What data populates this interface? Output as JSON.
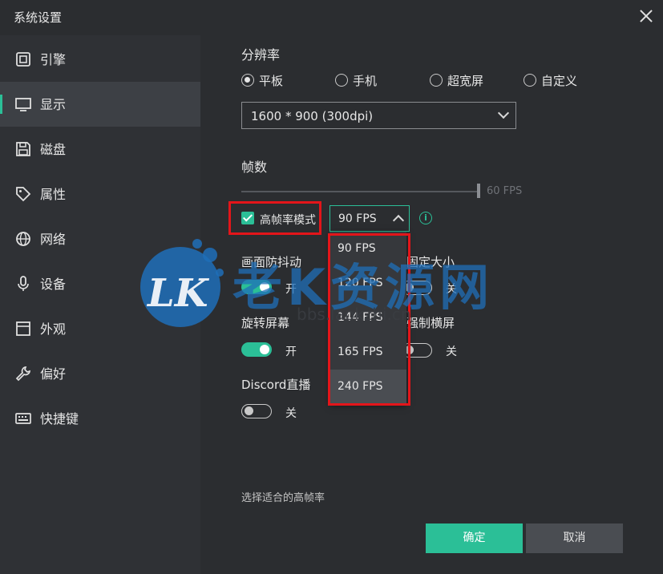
{
  "window": {
    "title": "系统设置"
  },
  "sidebar": {
    "items": [
      {
        "label": "引擎",
        "icon": "chip-icon"
      },
      {
        "label": "显示",
        "icon": "monitor-icon",
        "active": true
      },
      {
        "label": "磁盘",
        "icon": "save-disk-icon"
      },
      {
        "label": "属性",
        "icon": "tag-icon"
      },
      {
        "label": "网络",
        "icon": "globe-icon"
      },
      {
        "label": "设备",
        "icon": "microphone-icon"
      },
      {
        "label": "外观",
        "icon": "window-icon"
      },
      {
        "label": "偏好",
        "icon": "wrench-icon"
      },
      {
        "label": "快捷键",
        "icon": "keyboard-icon"
      }
    ]
  },
  "resolution": {
    "title": "分辨率",
    "options": [
      "平板",
      "手机",
      "超宽屏",
      "自定义"
    ],
    "selected_option": "平板",
    "select_value": "1600 * 900 (300dpi)"
  },
  "framerate": {
    "title": "帧数",
    "slider_value_label": "60 FPS",
    "high_fps_label": "高帧率模式",
    "high_fps_checked": true,
    "fps_selected": "90 FPS",
    "fps_options": [
      "90 FPS",
      "120 FPS",
      "144 FPS",
      "165 FPS",
      "240 FPS"
    ]
  },
  "toggles": {
    "anti_shake": {
      "label": "画面防抖动",
      "state_label": "开",
      "on": true
    },
    "fixed_size": {
      "label": "固定大小",
      "state_label": "关",
      "on": false
    },
    "rotate": {
      "label": "旋转屏幕",
      "state_label": "开",
      "on": true
    },
    "force_landscape": {
      "label": "强制横屏",
      "state_label": "关",
      "on": false
    },
    "discord": {
      "label": "Discord直播",
      "state_label": "关",
      "on": false
    }
  },
  "hint": "选择适合的高帧率",
  "buttons": {
    "ok": "确定",
    "cancel": "取消"
  },
  "watermark": {
    "logo": "LK",
    "text": "老K资源网",
    "url": "bbs.laokzhi.cn"
  },
  "colors": {
    "accent": "#2bbf97",
    "highlight": "#e3151a",
    "background": "#2b2d30",
    "sidebar": "#2f3135"
  }
}
